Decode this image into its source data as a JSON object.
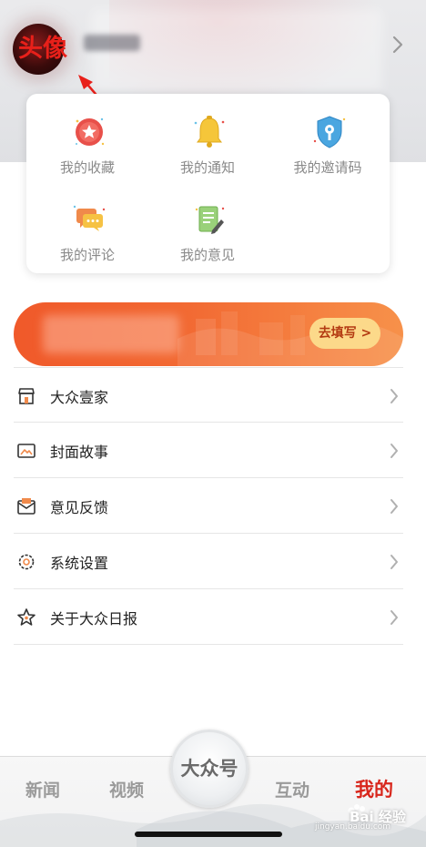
{
  "header": {
    "annotation_label": "头像",
    "chevron_icon": "chevron-right-icon"
  },
  "quick_actions": [
    {
      "label": "我的收藏",
      "icon": "favorite-badge-icon"
    },
    {
      "label": "我的通知",
      "icon": "bell-icon"
    },
    {
      "label": "我的邀请码",
      "icon": "shield-key-icon"
    },
    {
      "label": "我的评论",
      "icon": "comment-bubble-icon"
    },
    {
      "label": "我的意见",
      "icon": "note-pencil-icon"
    }
  ],
  "banner": {
    "button_label": "去填写 >"
  },
  "menu": [
    {
      "label": "大众壹家",
      "icon": "storefront-icon"
    },
    {
      "label": "封面故事",
      "icon": "picture-icon"
    },
    {
      "label": "意见反馈",
      "icon": "envelope-icon"
    },
    {
      "label": "系统设置",
      "icon": "gear-icon"
    },
    {
      "label": "关于大众日报",
      "icon": "star-icon"
    }
  ],
  "tabbar": {
    "tabs": [
      "新闻",
      "视频",
      "大众号",
      "互动",
      "我的"
    ],
    "active": "我的"
  },
  "watermark": {
    "text": "Bai 经验",
    "url": "jingyan.baidu.com"
  },
  "colors": {
    "accent_red": "#d8261c",
    "banner_orange": "#f26a33",
    "button_yellow": "#fcd98a",
    "annotation_red": "#e8201a"
  }
}
